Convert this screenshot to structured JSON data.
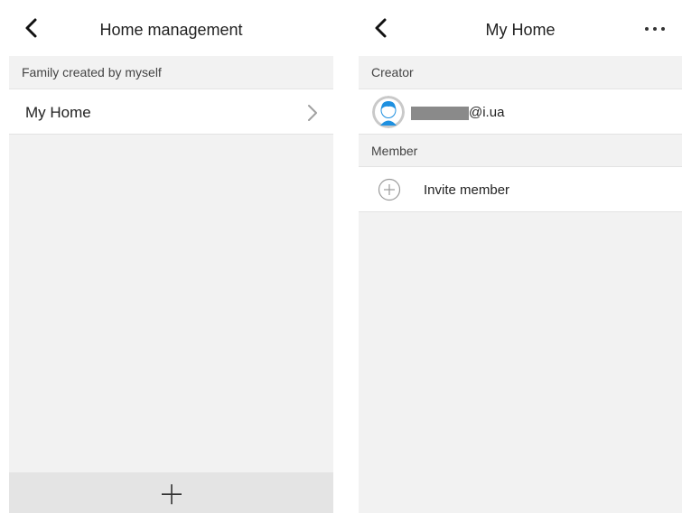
{
  "left_screen": {
    "nav": {
      "title": "Home management",
      "back_icon": "chevron-left-icon"
    },
    "section_header": "Family created by myself",
    "homes": [
      {
        "label": "My Home",
        "chevron_icon": "chevron-right-icon"
      }
    ],
    "bottom_bar": {
      "add_icon": "plus-icon"
    }
  },
  "right_screen": {
    "nav": {
      "title": "My Home",
      "back_icon": "chevron-left-icon",
      "more_icon": "more-dots-icon",
      "more_glyph": "···"
    },
    "creator_header": "Creator",
    "creator": {
      "email_visible": "@i.ua",
      "avatar_icon": "user-avatar-icon"
    },
    "member_header": "Member",
    "invite": {
      "label": "Invite member",
      "icon": "plus-circle-icon"
    }
  },
  "colors": {
    "background": "#f2f2f2",
    "row_background": "#ffffff",
    "divider": "#e3e3e3",
    "bottom_bar": "#e4e4e4",
    "avatar_blue": "#1e90e0",
    "redaction": "#8a8a8a",
    "text_primary": "#222222",
    "text_secondary": "#444444"
  }
}
